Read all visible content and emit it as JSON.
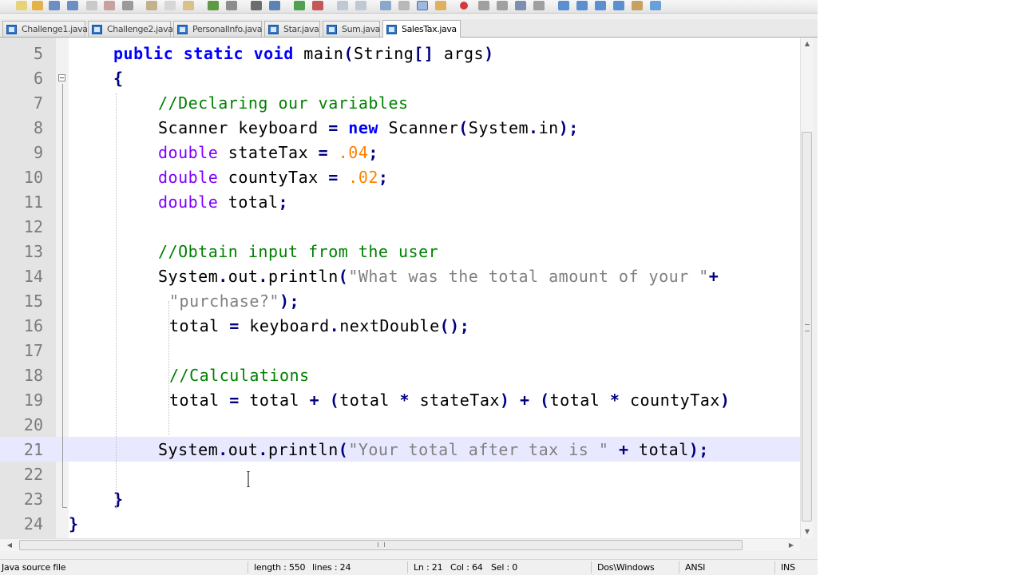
{
  "tabs": [
    {
      "label": "Challenge1.java",
      "active": false
    },
    {
      "label": "Challenge2.java",
      "active": false
    },
    {
      "label": "PersonalInfo.java",
      "active": false
    },
    {
      "label": "Star.java",
      "active": false
    },
    {
      "label": "Sum.java",
      "active": false
    },
    {
      "label": "SalesTax.java",
      "active": true
    }
  ],
  "editor": {
    "current_line": 21,
    "lines": [
      {
        "num": "5",
        "tokens": [
          {
            "t": "public",
            "c": "kw"
          },
          {
            "t": " "
          },
          {
            "t": "static",
            "c": "kw"
          },
          {
            "t": " "
          },
          {
            "t": "void",
            "c": "kw"
          },
          {
            "t": " main"
          },
          {
            "t": "(",
            "c": "op"
          },
          {
            "t": "String"
          },
          {
            "t": "[]",
            "c": "op"
          },
          {
            "t": " args"
          },
          {
            "t": ")",
            "c": "op"
          }
        ]
      },
      {
        "num": "6",
        "tokens": [
          {
            "t": "{",
            "c": "op"
          }
        ]
      },
      {
        "num": "7",
        "tokens": [
          {
            "t": "//Declaring our variables",
            "c": "cm"
          }
        ]
      },
      {
        "num": "8",
        "tokens": [
          {
            "t": "Scanner keyboard "
          },
          {
            "t": "=",
            "c": "op"
          },
          {
            "t": " "
          },
          {
            "t": "new",
            "c": "kw"
          },
          {
            "t": " Scanner"
          },
          {
            "t": "(",
            "c": "op"
          },
          {
            "t": "System"
          },
          {
            "t": ".",
            "c": "op"
          },
          {
            "t": "in"
          },
          {
            "t": ");",
            "c": "op"
          }
        ]
      },
      {
        "num": "9",
        "tokens": [
          {
            "t": "double",
            "c": "kt"
          },
          {
            "t": " stateTax "
          },
          {
            "t": "=",
            "c": "op"
          },
          {
            "t": " "
          },
          {
            "t": ".04",
            "c": "num"
          },
          {
            "t": ";",
            "c": "op"
          }
        ]
      },
      {
        "num": "10",
        "tokens": [
          {
            "t": "double",
            "c": "kt"
          },
          {
            "t": " countyTax "
          },
          {
            "t": "=",
            "c": "op"
          },
          {
            "t": " "
          },
          {
            "t": ".02",
            "c": "num"
          },
          {
            "t": ";",
            "c": "op"
          }
        ]
      },
      {
        "num": "11",
        "tokens": [
          {
            "t": "double",
            "c": "kt"
          },
          {
            "t": " total"
          },
          {
            "t": ";",
            "c": "op"
          }
        ]
      },
      {
        "num": "12",
        "tokens": []
      },
      {
        "num": "13",
        "tokens": [
          {
            "t": "//Obtain input from the user",
            "c": "cm"
          }
        ]
      },
      {
        "num": "14",
        "tokens": [
          {
            "t": "System"
          },
          {
            "t": ".",
            "c": "op"
          },
          {
            "t": "out"
          },
          {
            "t": ".",
            "c": "op"
          },
          {
            "t": "println"
          },
          {
            "t": "(",
            "c": "op"
          },
          {
            "t": "\"What was the total amount of your \"",
            "c": "str"
          },
          {
            "t": "+",
            "c": "op"
          }
        ]
      },
      {
        "num": "15",
        "tokens": [
          {
            "t": "\"purchase?\"",
            "c": "str"
          },
          {
            "t": ");",
            "c": "op"
          }
        ]
      },
      {
        "num": "16",
        "tokens": [
          {
            "t": "total "
          },
          {
            "t": "=",
            "c": "op"
          },
          {
            "t": " keyboard"
          },
          {
            "t": ".",
            "c": "op"
          },
          {
            "t": "nextDouble"
          },
          {
            "t": "();",
            "c": "op"
          }
        ]
      },
      {
        "num": "17",
        "tokens": []
      },
      {
        "num": "18",
        "tokens": [
          {
            "t": "//Calculations",
            "c": "cm"
          }
        ]
      },
      {
        "num": "19",
        "tokens": [
          {
            "t": "total "
          },
          {
            "t": "=",
            "c": "op"
          },
          {
            "t": " total "
          },
          {
            "t": "+",
            "c": "op"
          },
          {
            "t": " "
          },
          {
            "t": "(",
            "c": "op"
          },
          {
            "t": "total "
          },
          {
            "t": "*",
            "c": "op"
          },
          {
            "t": " stateTax"
          },
          {
            "t": ")",
            "c": "op"
          },
          {
            "t": " "
          },
          {
            "t": "+",
            "c": "op"
          },
          {
            "t": " "
          },
          {
            "t": "(",
            "c": "op"
          },
          {
            "t": "total "
          },
          {
            "t": "*",
            "c": "op"
          },
          {
            "t": " countyTax"
          },
          {
            "t": ")",
            "c": "op"
          }
        ]
      },
      {
        "num": "20",
        "tokens": []
      },
      {
        "num": "21",
        "tokens": [
          {
            "t": "System"
          },
          {
            "t": ".",
            "c": "op"
          },
          {
            "t": "out"
          },
          {
            "t": ".",
            "c": "op"
          },
          {
            "t": "println"
          },
          {
            "t": "(",
            "c": "op"
          },
          {
            "t": "\"Your total after tax is \"",
            "c": "str"
          },
          {
            "t": " "
          },
          {
            "t": "+",
            "c": "op"
          },
          {
            "t": " total"
          },
          {
            "t": ");",
            "c": "op"
          }
        ]
      },
      {
        "num": "22",
        "tokens": []
      },
      {
        "num": "23",
        "tokens": [
          {
            "t": "}",
            "c": "op"
          }
        ]
      },
      {
        "num": "24",
        "tokens": [
          {
            "t": "}",
            "c": "op"
          }
        ]
      }
    ]
  },
  "status": {
    "file_type": "Java source file",
    "length": "length : 550",
    "lines": "lines : 24",
    "ln": "Ln : 21",
    "col": "Col : 64",
    "sel": "Sel : 0",
    "eol": "Dos\\Windows",
    "encoding": "ANSI",
    "mode": "INS"
  },
  "colors": {
    "keyword": "#0000ff",
    "type": "#8000ff",
    "comment": "#008000",
    "number": "#ff8000",
    "string": "#808080",
    "operator": "#000080",
    "current_line": "#e8e8ff"
  }
}
